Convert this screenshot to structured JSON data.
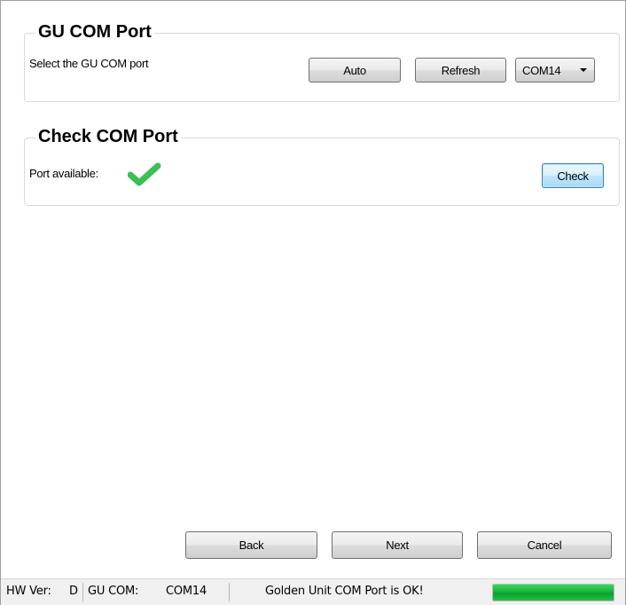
{
  "gu_com_port": {
    "title": "GU COM Port",
    "instruction": "Select the GU COM port",
    "auto_label": "Auto",
    "refresh_label": "Refresh",
    "selected_port": "COM14"
  },
  "check_com_port": {
    "title": "Check COM Port",
    "port_available_label": "Port available:",
    "check_label": "Check",
    "status_icon": "checkmark-icon",
    "status_color": "#3cbf55"
  },
  "nav": {
    "back_label": "Back",
    "next_label": "Next",
    "cancel_label": "Cancel"
  },
  "statusbar": {
    "hw_ver_label": "HW Ver:",
    "hw_ver_value": "D",
    "gu_com_label": "GU COM:",
    "gu_com_value": "COM14",
    "message": "Golden Unit COM Port is OK!",
    "progress_fraction": 1.0,
    "progress_color": "#17b33b"
  }
}
